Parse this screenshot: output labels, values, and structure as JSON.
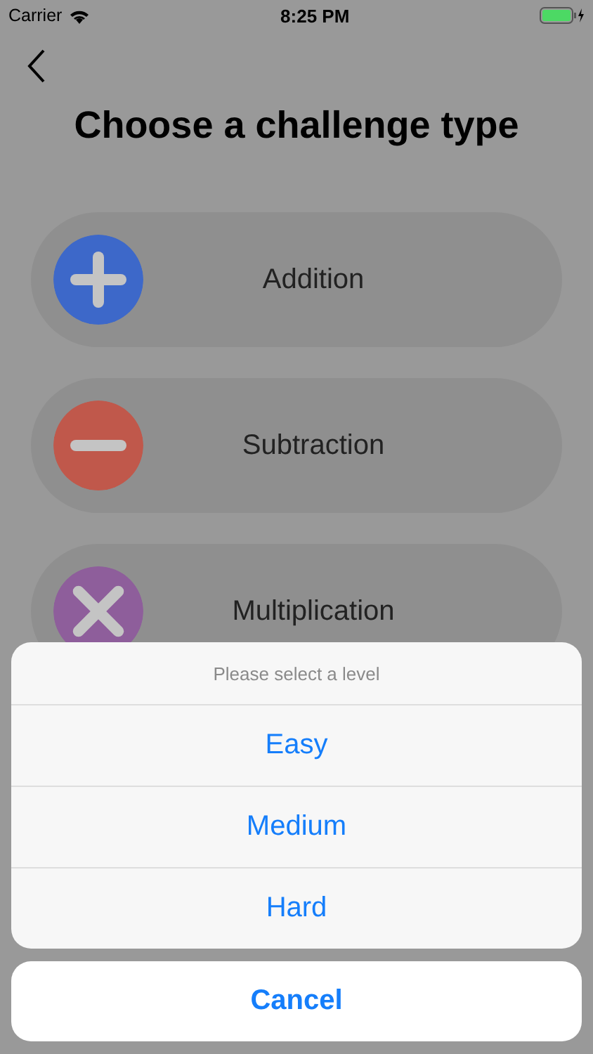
{
  "status_bar": {
    "carrier": "Carrier",
    "time": "8:25 PM"
  },
  "title": "Choose a challenge type",
  "challenges": [
    {
      "label": "Addition",
      "kind": "plus",
      "color": "#3d68c9"
    },
    {
      "label": "Subtraction",
      "kind": "minus",
      "color": "#c0584b"
    },
    {
      "label": "Multiplication",
      "kind": "times",
      "color": "#8e5e9b"
    }
  ],
  "action_sheet": {
    "message": "Please select a level",
    "options": [
      "Easy",
      "Medium",
      "Hard"
    ],
    "cancel": "Cancel"
  }
}
